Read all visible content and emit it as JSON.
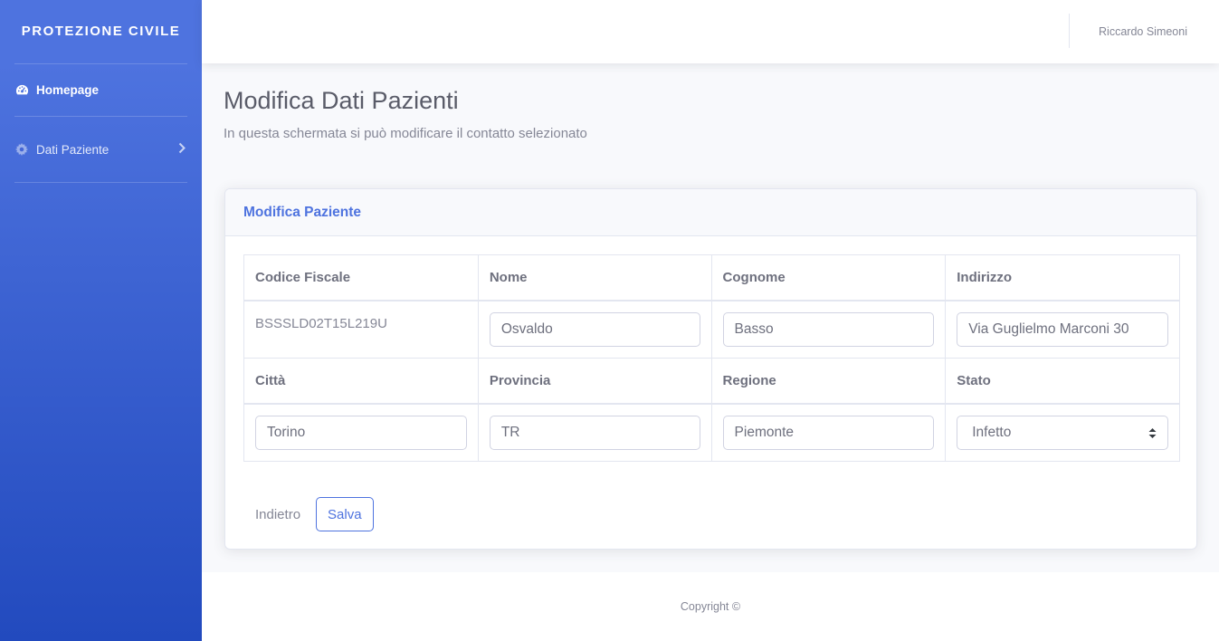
{
  "sidebar": {
    "brand": "PROTEZIONE CIVILE",
    "items": [
      {
        "label": "Homepage",
        "icon": "tachometer-icon",
        "active": true
      },
      {
        "label": "Dati Paziente",
        "icon": "cog-icon",
        "active": false
      }
    ]
  },
  "topbar": {
    "user_name": "Riccardo Simeoni"
  },
  "page": {
    "title": "Modifica Dati Pazienti",
    "subtitle": "In questa schermata si può modificare il contatto selezionato"
  },
  "card": {
    "title": "Modifica Paziente",
    "headers_row1": [
      "Codice Fiscale",
      "Nome",
      "Cognome",
      "Indirizzo"
    ],
    "headers_row2": [
      "Città",
      "Provincia",
      "Regione",
      "Stato"
    ],
    "values": {
      "codice_fiscale": "BSSSLD02T15L219U",
      "nome": "Osvaldo",
      "cognome": "Basso",
      "indirizzo": "Via Guglielmo Marconi 30",
      "citta": "Torino",
      "provincia": "TR",
      "regione": "Piemonte",
      "stato": "Infetto"
    },
    "back_label": "Indietro",
    "save_label": "Salva"
  },
  "footer": {
    "copyright": "Copyright ©"
  },
  "colors": {
    "primary": "#4e73df",
    "sidebar_bottom": "#224abe",
    "text_muted": "#858796"
  }
}
